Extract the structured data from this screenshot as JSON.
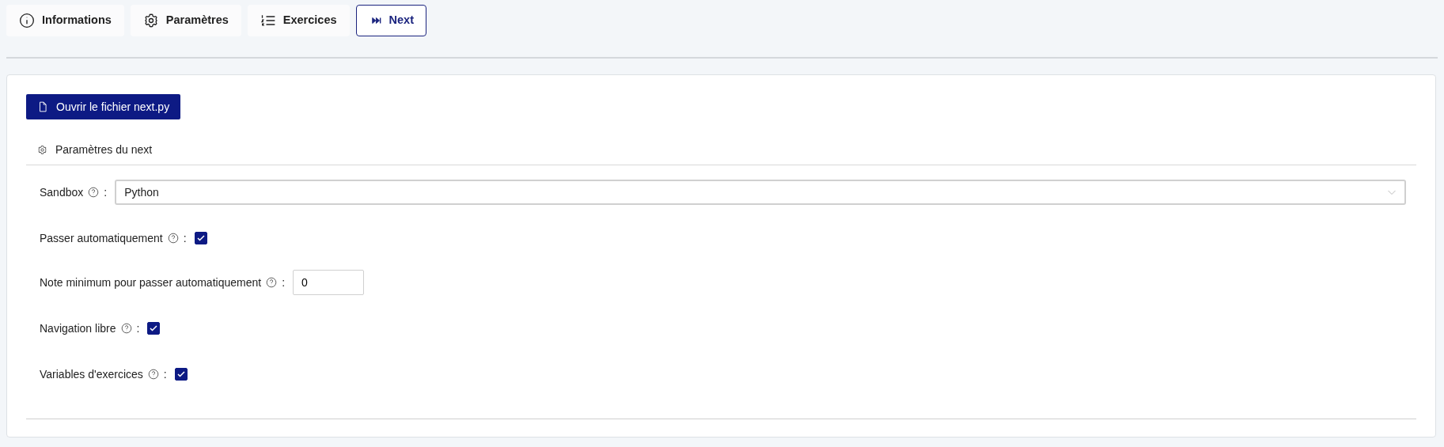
{
  "tabs": [
    {
      "label": "Informations",
      "selected": false
    },
    {
      "label": "Paramètres",
      "selected": false
    },
    {
      "label": "Exercices",
      "selected": false
    },
    {
      "label": "Next",
      "selected": true
    }
  ],
  "open_button": {
    "label": "Ouvrir le fichier next.py"
  },
  "section": {
    "title": "Paramètres du next"
  },
  "fields": [
    {
      "kind": "select",
      "label": "Sandbox",
      "colon": ":",
      "value": "Python"
    },
    {
      "kind": "checkbox",
      "label": "Passer automatiquement",
      "colon": ":",
      "checked": true
    },
    {
      "kind": "number",
      "label": "Note minimum pour passer automatiquement",
      "colon": ":",
      "value": "0"
    },
    {
      "kind": "checkbox",
      "label": "Navigation libre",
      "colon": ":",
      "checked": true
    },
    {
      "kind": "checkbox",
      "label": "Variables d'exercices",
      "colon": ":",
      "checked": true
    }
  ]
}
